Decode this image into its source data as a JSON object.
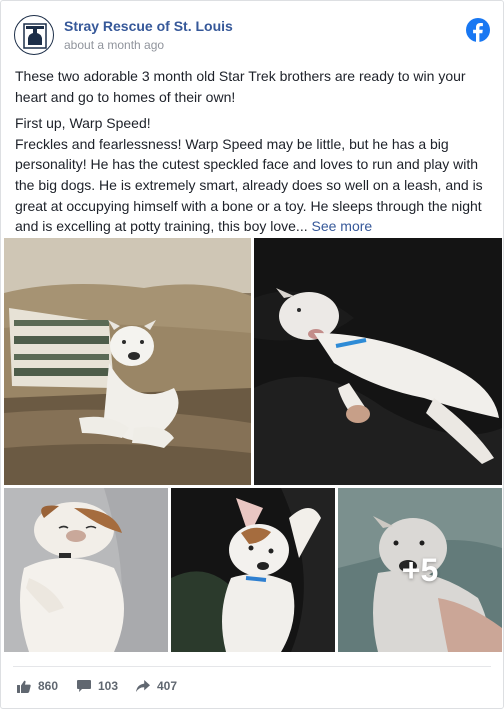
{
  "header": {
    "page_name": "Stray Rescue of St. Louis",
    "timestamp": "about a month ago",
    "avatar_icon": "stray-rescue-logo-icon",
    "platform_icon": "facebook-logo-icon",
    "brand_color": "#1877f2"
  },
  "post": {
    "paragraph1": "These two adorable 3 month old Star Trek brothers are ready to win your heart and go to homes of their own!",
    "paragraph2_heading": "First up, Warp Speed!",
    "paragraph2_body": "Freckles and fearlessness! Warp Speed may be little, but he has a big personality! He has the cutest speckled face and loves to run and play with the big dogs. He is extremely smart, already does so well on a leash, and is great at occupying himself with a bone or a toy. He sleeps through the night and is excelling at potty training, this boy love...",
    "see_more": "See more"
  },
  "photos": {
    "items": [
      "white puppy lying on tan couch with striped pillow",
      "white puppy lying on back on dark blanket",
      "brown and white puppy sleeping on gray blanket",
      "white puppy with brown ear on back",
      "white puppy on light blanket"
    ],
    "more_count": "+5"
  },
  "stats": {
    "likes": "860",
    "comments": "103",
    "shares": "407",
    "like_icon": "thumbs-up-icon",
    "comment_icon": "comment-icon",
    "share_icon": "share-arrow-icon"
  }
}
